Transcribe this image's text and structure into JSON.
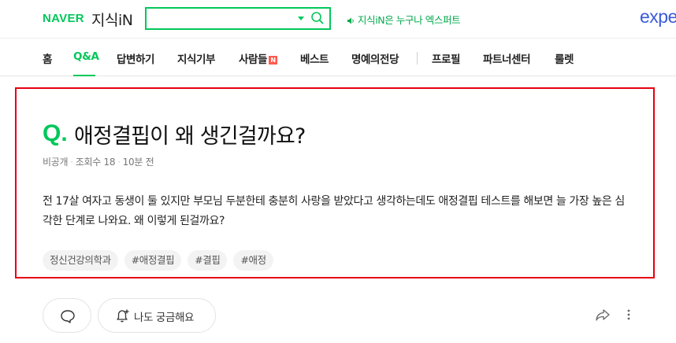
{
  "header": {
    "brand": "NAVER",
    "service": "지식iN",
    "search": {
      "value": "",
      "placeholder": ""
    },
    "notice": "지식iN은 누구나 엑스퍼트",
    "partner_logo": "expe",
    "icons": [
      "search-icon",
      "dropdown-arrow-icon",
      "speaker-icon"
    ],
    "accent_color": "#03c75a"
  },
  "nav": {
    "items": [
      {
        "label": "홈"
      },
      {
        "label": "Q&A",
        "active": true
      },
      {
        "label": "답변하기"
      },
      {
        "label": "지식기부"
      },
      {
        "label": "사람들",
        "badge": "N"
      },
      {
        "label": "베스트"
      },
      {
        "label": "명예의전당"
      },
      {
        "label": "프로필"
      },
      {
        "label": "파트너센터"
      },
      {
        "label": "룰렛"
      }
    ]
  },
  "question": {
    "q_mark": "Q.",
    "title": "애정결핍이 왜 생긴걸까요?",
    "visibility": "비공개",
    "views": "조회수 18",
    "time": "10분 전",
    "body": "전 17살 여자고 동생이 둘 있지만 부모님 두분한테 충분히 사랑을 받았다고 생각하는데도 애정결핍 테스트를 해보면 늘 가장 높은 심각한 단계로 나와요. 왜 이렇게 된걸까요?",
    "tags": [
      "정신건강의학과",
      "#애정결핍",
      "#결핍",
      "#애정"
    ],
    "highlight_color": "#e60012"
  },
  "actions": {
    "curious_label": "나도 궁금해요",
    "icons": [
      "comment-icon",
      "bell-plus-icon",
      "share-icon",
      "more-icon"
    ]
  }
}
